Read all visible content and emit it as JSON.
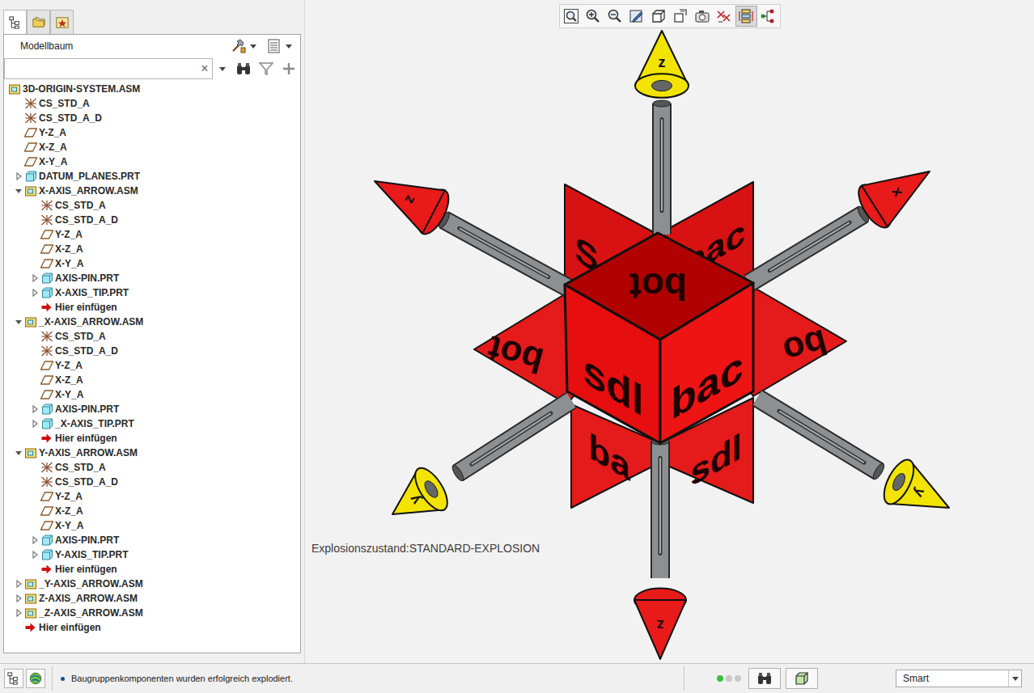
{
  "tabs": [
    {
      "selected": true
    },
    {
      "selected": false
    },
    {
      "selected": false
    }
  ],
  "model_tree": {
    "title": "Modellbaum",
    "search": {
      "value": "",
      "clear": "×"
    },
    "items": [
      {
        "label": "3D-ORIGIN-SYSTEM.ASM",
        "kind": "assembly",
        "level": 0,
        "expandable": false,
        "expanded": false
      },
      {
        "label": "CS_STD_A",
        "kind": "csys",
        "level": 1,
        "expandable": false,
        "expanded": false
      },
      {
        "label": "CS_STD_A_D",
        "kind": "csys",
        "level": 1,
        "expandable": false,
        "expanded": false
      },
      {
        "label": "Y-Z_A",
        "kind": "plane",
        "level": 1,
        "expandable": false,
        "expanded": false
      },
      {
        "label": "X-Z_A",
        "kind": "plane",
        "level": 1,
        "expandable": false,
        "expanded": false
      },
      {
        "label": "X-Y_A",
        "kind": "plane",
        "level": 1,
        "expandable": false,
        "expanded": false
      },
      {
        "label": "DATUM_PLANES.PRT",
        "kind": "part",
        "level": 1,
        "expandable": true,
        "expanded": false
      },
      {
        "label": "X-AXIS_ARROW.ASM",
        "kind": "assembly",
        "level": 1,
        "expandable": true,
        "expanded": true
      },
      {
        "label": "CS_STD_A",
        "kind": "csys",
        "level": 2,
        "expandable": false,
        "expanded": false
      },
      {
        "label": "CS_STD_A_D",
        "kind": "csys",
        "level": 2,
        "expandable": false,
        "expanded": false
      },
      {
        "label": "Y-Z_A",
        "kind": "plane",
        "level": 2,
        "expandable": false,
        "expanded": false
      },
      {
        "label": "X-Z_A",
        "kind": "plane",
        "level": 2,
        "expandable": false,
        "expanded": false
      },
      {
        "label": "X-Y_A",
        "kind": "plane",
        "level": 2,
        "expandable": false,
        "expanded": false
      },
      {
        "label": "AXIS-PIN.PRT",
        "kind": "part",
        "level": 2,
        "expandable": true,
        "expanded": false
      },
      {
        "label": "X-AXIS_TIP.PRT",
        "kind": "part",
        "level": 2,
        "expandable": true,
        "expanded": false
      },
      {
        "label": "Hier einfügen",
        "kind": "insert",
        "level": 2,
        "expandable": false,
        "expanded": false
      },
      {
        "label": "_X-AXIS_ARROW.ASM",
        "kind": "assembly",
        "level": 1,
        "expandable": true,
        "expanded": true
      },
      {
        "label": "CS_STD_A",
        "kind": "csys",
        "level": 2,
        "expandable": false,
        "expanded": false
      },
      {
        "label": "CS_STD_A_D",
        "kind": "csys",
        "level": 2,
        "expandable": false,
        "expanded": false
      },
      {
        "label": "Y-Z_A",
        "kind": "plane",
        "level": 2,
        "expandable": false,
        "expanded": false
      },
      {
        "label": "X-Z_A",
        "kind": "plane",
        "level": 2,
        "expandable": false,
        "expanded": false
      },
      {
        "label": "X-Y_A",
        "kind": "plane",
        "level": 2,
        "expandable": false,
        "expanded": false
      },
      {
        "label": "AXIS-PIN.PRT",
        "kind": "part",
        "level": 2,
        "expandable": true,
        "expanded": false
      },
      {
        "label": "_X-AXIS_TIP.PRT",
        "kind": "part",
        "level": 2,
        "expandable": true,
        "expanded": false
      },
      {
        "label": "Hier einfügen",
        "kind": "insert",
        "level": 2,
        "expandable": false,
        "expanded": false
      },
      {
        "label": "Y-AXIS_ARROW.ASM",
        "kind": "assembly",
        "level": 1,
        "expandable": true,
        "expanded": true
      },
      {
        "label": "CS_STD_A",
        "kind": "csys",
        "level": 2,
        "expandable": false,
        "expanded": false
      },
      {
        "label": "CS_STD_A_D",
        "kind": "csys",
        "level": 2,
        "expandable": false,
        "expanded": false
      },
      {
        "label": "Y-Z_A",
        "kind": "plane",
        "level": 2,
        "expandable": false,
        "expanded": false
      },
      {
        "label": "X-Z_A",
        "kind": "plane",
        "level": 2,
        "expandable": false,
        "expanded": false
      },
      {
        "label": "X-Y_A",
        "kind": "plane",
        "level": 2,
        "expandable": false,
        "expanded": false
      },
      {
        "label": "AXIS-PIN.PRT",
        "kind": "part",
        "level": 2,
        "expandable": true,
        "expanded": false
      },
      {
        "label": "Y-AXIS_TIP.PRT",
        "kind": "part",
        "level": 2,
        "expandable": true,
        "expanded": false
      },
      {
        "label": "Hier einfügen",
        "kind": "insert",
        "level": 2,
        "expandable": false,
        "expanded": false
      },
      {
        "label": "_Y-AXIS_ARROW.ASM",
        "kind": "assembly",
        "level": 1,
        "expandable": true,
        "expanded": false
      },
      {
        "label": "Z-AXIS_ARROW.ASM",
        "kind": "assembly",
        "level": 1,
        "expandable": true,
        "expanded": false
      },
      {
        "label": "_Z-AXIS_ARROW.ASM",
        "kind": "assembly",
        "level": 1,
        "expandable": true,
        "expanded": false
      },
      {
        "label": "Hier einfügen",
        "kind": "insert",
        "level": 1,
        "expandable": false,
        "expanded": false
      }
    ]
  },
  "viewport": {
    "toolbar": [
      {
        "selected": false
      },
      {
        "selected": false
      },
      {
        "selected": false
      },
      {
        "selected": false
      },
      {
        "selected": false
      },
      {
        "selected": false
      },
      {
        "selected": false
      },
      {
        "selected": false
      },
      {
        "selected": true
      },
      {
        "selected": false
      }
    ],
    "explode_state": "Explosionszustand:STANDARD-EXPLOSION",
    "cube_faces": {
      "top": "bot",
      "left": "sdl",
      "right": "bac"
    },
    "panel_labels": [
      "S",
      "bac",
      "bot",
      "bo",
      "ba",
      "sdl"
    ],
    "axes": [
      {
        "label": "z",
        "color": "#f2e400"
      },
      {
        "label": "z",
        "color": "#e81a1a"
      },
      {
        "label": "x",
        "color": "#e81a1a"
      },
      {
        "label": "y",
        "color": "#f2e400"
      },
      {
        "label": "y",
        "color": "#f2e400"
      },
      {
        "label": "z",
        "color": "#e81a1a"
      }
    ]
  },
  "status_bar": {
    "message": "Baugruppenkomponenten wurden erfolgreich explodiert.",
    "busy_dots": [
      {
        "on": true
      },
      {
        "on": false
      },
      {
        "on": false
      }
    ],
    "filter": {
      "value": "Smart"
    }
  }
}
